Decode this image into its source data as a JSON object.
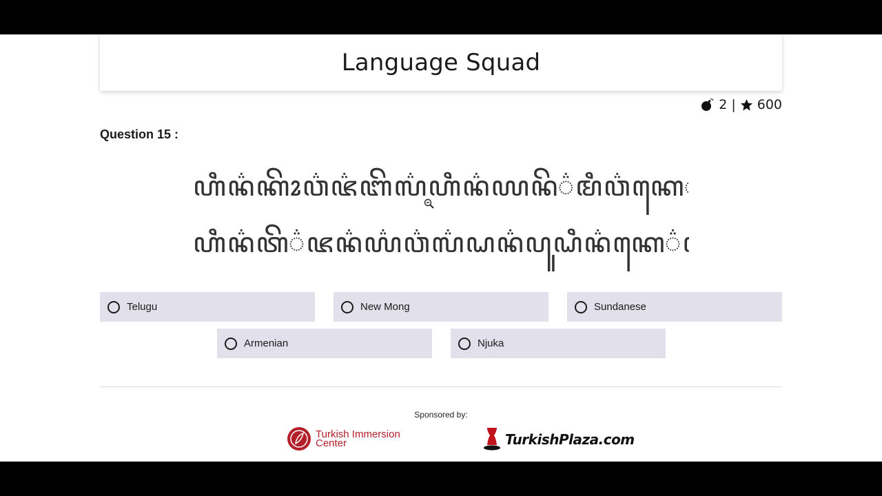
{
  "app": {
    "title": "Language Squad"
  },
  "score": {
    "bombs": "2",
    "separator": "|",
    "stars": "600"
  },
  "question": {
    "label": "Question 15 :",
    "script_lines": [
      "ꦲꦶꦤ꦳ꦏꦼꦴꦮ꦳ꦗ꦳ꦧꦼꦭ꦳ꦲꦶꦤ꦳ꦪꦤꦼ꦳ꦩꦶꦮ꦳ꦏꦺ꦳ꦝꦺꦴ꦳ꦪꦺ꦳ꦗꦤꦸ꦳",
      "ꦲꦶꦤ꦳ꦠꦼ꦳ꦗꦤ꦳ꦪ꦳ꦮ꦳ꦭ꦳ꦝꦤ꦳ꦥꦸꦝꦶꦤ꦳ꦏꦺ꦳ꦥ꦳ꦪꦤꦼ꦳"
    ]
  },
  "options": [
    {
      "label": "Telugu"
    },
    {
      "label": "New Mong"
    },
    {
      "label": "Sundanese"
    },
    {
      "label": "Armenian"
    },
    {
      "label": "Njuka"
    }
  ],
  "footer": {
    "sponsored_label": "Sponsored by:",
    "sponsor1_line1": "Turkish Immersion",
    "sponsor1_line2": "Center",
    "sponsor2": "TurkishPlaza.com"
  },
  "colors": {
    "option_bg": "#e2e0eb",
    "brand_red": "#b3202a"
  },
  "icons": {
    "bomb": "bomb-icon",
    "star": "star-icon",
    "zoom": "zoom-out-cursor-icon"
  }
}
